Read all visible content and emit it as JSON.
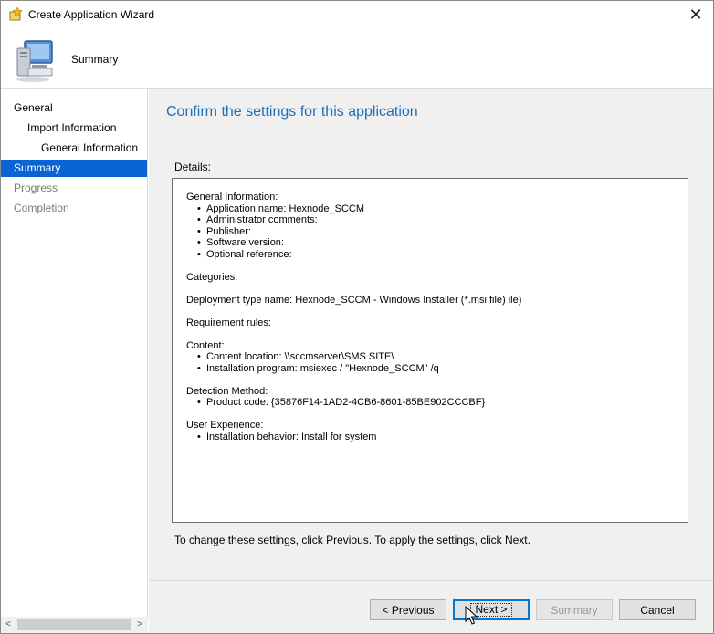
{
  "window": {
    "title": "Create Application Wizard"
  },
  "header": {
    "title": "Summary"
  },
  "sidebar": {
    "items": [
      {
        "label": "General",
        "state": "normal",
        "indent": 0
      },
      {
        "label": "Import Information",
        "state": "normal",
        "indent": 1
      },
      {
        "label": "General Information",
        "state": "normal",
        "indent": 2
      },
      {
        "label": "Summary",
        "state": "selected",
        "indent": 0
      },
      {
        "label": "Progress",
        "state": "disabled",
        "indent": 0
      },
      {
        "label": "Completion",
        "state": "disabled",
        "indent": 0
      }
    ]
  },
  "main": {
    "heading": "Confirm the settings for this application",
    "details_label": "Details:",
    "details": [
      {
        "title": "General Information:",
        "items": [
          "Application name:  Hexnode_SCCM",
          "Administrator comments:",
          "Publisher:",
          "Software version:",
          "Optional reference:"
        ]
      },
      {
        "title": "Categories:",
        "items": []
      },
      {
        "title": "Deployment type name:  Hexnode_SCCM - Windows Installer (*.msi file)  ile)",
        "items": []
      },
      {
        "title": "Requirement rules:",
        "items": []
      },
      {
        "title": "Content:",
        "items": [
          "Content location:  \\\\sccmserver\\SMS  SITE\\",
          "Installation program:  msiexec /  \"Hexnode_SCCM\" /q"
        ]
      },
      {
        "title": "Detection Method:",
        "items": [
          "Product code:  {35876F14-1AD2-4CB6-8601-85BE902CCCBF}"
        ]
      },
      {
        "title": "User Experience:",
        "items": [
          "Installation behavior:  Install for system"
        ]
      }
    ],
    "hint": "To change these settings, click Previous. To apply the settings, click Next."
  },
  "buttons": {
    "previous": "< Previous",
    "next": "Next >",
    "summary": "Summary",
    "cancel": "Cancel"
  },
  "colors": {
    "accent": "#0a64d6",
    "heading": "#1e6fb5"
  }
}
